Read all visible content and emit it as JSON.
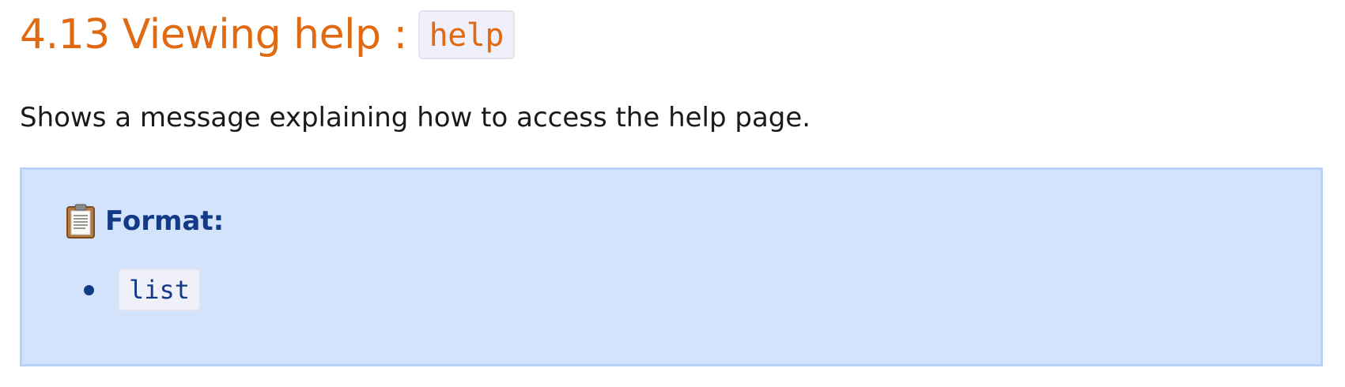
{
  "section": {
    "title": "4.13 Viewing help :",
    "command_code": "help",
    "description": "Shows a message explaining how to access the help page."
  },
  "format_box": {
    "icon": "clipboard-icon",
    "label": "Format:",
    "items": [
      "list"
    ]
  },
  "colors": {
    "heading": "#e06a12",
    "box_background": "#d3e3fc",
    "box_border": "#b8d2f7",
    "box_text": "#123a86",
    "code_background": "#f0f0fb"
  }
}
